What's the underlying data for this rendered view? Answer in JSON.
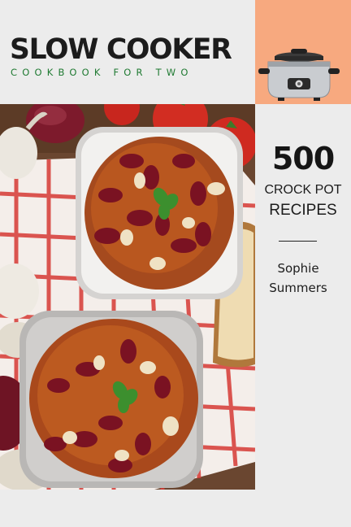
{
  "cover": {
    "title": "SLOW COOKER",
    "subtitle": "COOKBOOK FOR TWO",
    "count": "500",
    "line1": "CROCK POT",
    "line2": "RECIPES",
    "author_first": "Sophie",
    "author_last": "Summers"
  },
  "colors": {
    "background": "#ececec",
    "accent_peach": "#f7a97f",
    "subtitle_green": "#1f7a32",
    "title_text": "#1c1c1c"
  },
  "icons": [
    "slow-cooker-icon"
  ]
}
